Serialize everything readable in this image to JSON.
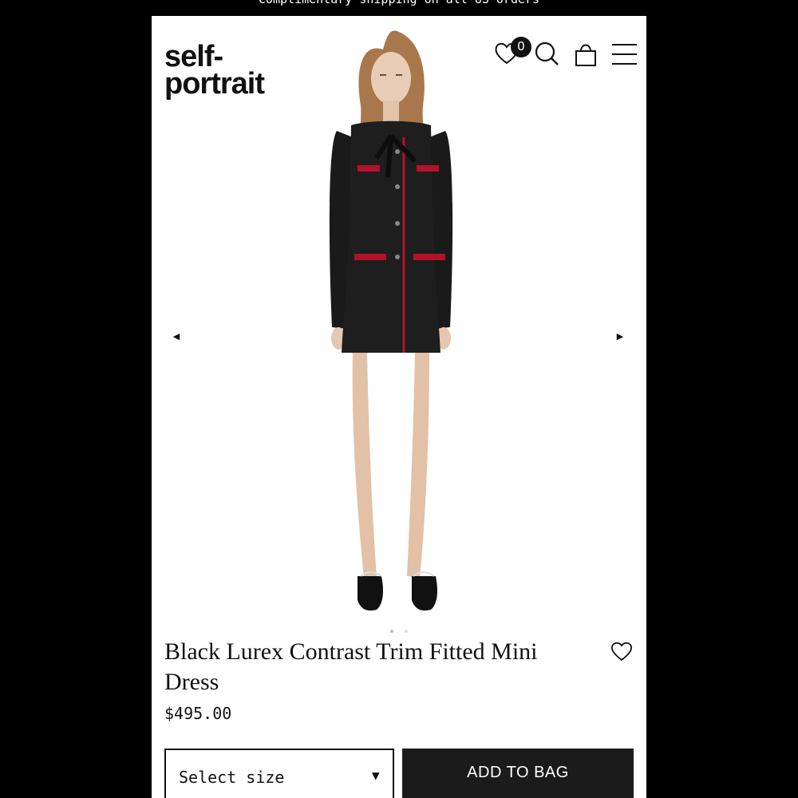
{
  "promo": {
    "text": "Complimentary shipping on all US orders"
  },
  "header": {
    "logo_line1": "self-",
    "logo_line2": "portrait",
    "wishlist_count": "0",
    "icons": [
      "heart-icon",
      "search-icon",
      "shopping-bag-icon",
      "hamburger-menu-icon"
    ]
  },
  "gallery": {
    "prev_arrow": "◀",
    "next_arrow": "▶",
    "image_description": "model-in-black-lurex-mini-dress"
  },
  "product": {
    "title": "Black Lurex Contrast Trim Fitted Mini Dress",
    "price": "$495.00"
  },
  "actions": {
    "size_placeholder": "Select size",
    "size_caret": "▼",
    "add_to_bag": "ADD TO BAG"
  },
  "colors": {
    "accent_trim": "#b3122a",
    "button_bg": "#1b1b1b"
  }
}
